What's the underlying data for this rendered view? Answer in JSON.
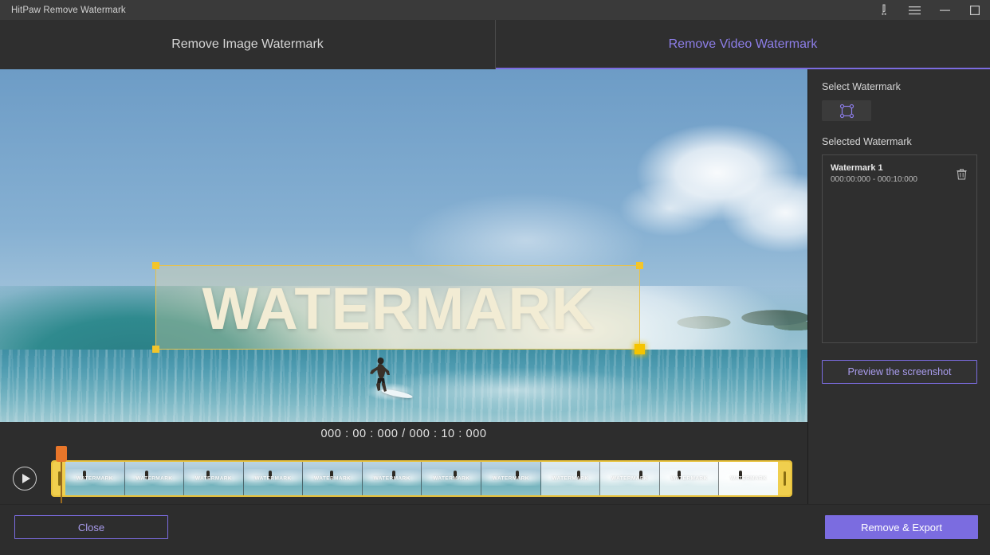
{
  "window": {
    "title": "HitPaw Remove Watermark",
    "controls": [
      {
        "name": "feedback-icon",
        "label": "Feedback"
      },
      {
        "name": "menu-icon",
        "label": "Menu"
      },
      {
        "name": "minimize-icon",
        "label": "Minimize"
      },
      {
        "name": "maximize-icon",
        "label": "Maximize"
      }
    ]
  },
  "tabs": [
    {
      "label": "Remove Image Watermark",
      "active": false
    },
    {
      "label": "Remove Video Watermark",
      "active": true
    }
  ],
  "stage": {
    "watermark_overlay_text": "WATERMARK"
  },
  "timeline": {
    "timecode": "000 : 00 : 000 / 000 : 10 : 000",
    "current_time": "000 : 00 : 000",
    "total_time": "000 : 10 : 000",
    "play_label": "Play",
    "thumbnail_count": 12,
    "thumbnail_watermark_text": "WATERMARK"
  },
  "panel": {
    "select_watermark_label": "Select Watermark",
    "select_tool_icon": "marquee-select-icon",
    "selected_watermark_label": "Selected Watermark",
    "watermarks": [
      {
        "title": "Watermark 1",
        "range": "000:00:000 - 000:10:000",
        "delete_icon": "trash-icon"
      }
    ],
    "preview_button": "Preview the screenshot"
  },
  "footer": {
    "close_label": "Close",
    "export_label": "Remove & Export"
  },
  "colors": {
    "accent": "#7b6ce0",
    "accent_text": "#a99ced",
    "selection_handle": "#f3c52a",
    "playhead": "#e8762a",
    "timeline_border": "#e8c23c",
    "window_bg": "#2d2d2d",
    "titlebar_bg": "#3a3a3a"
  }
}
